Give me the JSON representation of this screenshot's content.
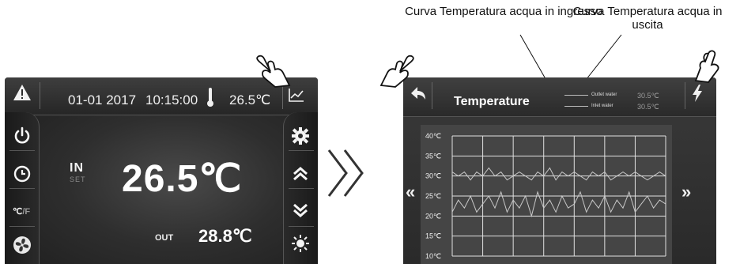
{
  "annotations": {
    "inlet_curve": "Curva Temperatura acqua in ingresso",
    "outlet_curve": "Curva Temperatura acqua in uscita"
  },
  "main_screen": {
    "date": "01-01 2017",
    "time": "10:15:00",
    "ambient_temp": "26.5℃",
    "mode_label": "IN",
    "set_label": "SET",
    "set_temp": "26.5℃",
    "out_label": "OUT",
    "out_temp": "28.8℃",
    "unit_toggle": {
      "c": "℃",
      "f": "/F"
    },
    "icons": {
      "top_left": "warning-icon",
      "top_right": "chart-icon",
      "left_rail": [
        "power-icon",
        "clock-icon",
        "unit-toggle-icon",
        "fan-icon"
      ],
      "right_rail": [
        "gear-icon",
        "chevron-up-icon",
        "chevron-down-icon",
        "sun-icon"
      ]
    }
  },
  "temperature_screen": {
    "title": "Temperature",
    "legend": [
      {
        "name": "Outlet water",
        "value": "30.5℃"
      },
      {
        "name": "Inlet water",
        "value": "30.5℃"
      }
    ],
    "nav_prev": "«",
    "nav_next": "»",
    "icons": {
      "top_left": "back-arrow-icon",
      "top_right": "lightning-icon"
    }
  },
  "chart_data": {
    "type": "line",
    "y_ticks": [
      "40℃",
      "35℃",
      "30℃",
      "25℃",
      "20℃",
      "15℃",
      "10℃"
    ],
    "ylim": [
      10,
      40
    ],
    "grid": true,
    "series": [
      {
        "name": "Outlet water",
        "values": [
          31,
          30,
          31,
          29,
          31,
          30,
          32,
          30,
          31,
          29,
          30,
          31,
          30,
          29,
          31,
          30,
          32,
          29,
          31,
          30,
          31,
          30,
          29,
          31,
          30,
          31,
          29,
          30,
          31,
          30,
          31,
          30,
          29,
          30,
          31,
          30
        ]
      },
      {
        "name": "Inlet water",
        "values": [
          21,
          24,
          22,
          25,
          21,
          23,
          25,
          22,
          26,
          21,
          24,
          22,
          25,
          20,
          26,
          22,
          24,
          21,
          25,
          22,
          23,
          26,
          21,
          24,
          22,
          25,
          21,
          24,
          22,
          26,
          21,
          23,
          25,
          22,
          24,
          23
        ]
      }
    ]
  },
  "colors": {
    "screen_bg": "#2a2a2a",
    "graph_bg": "#454545",
    "grid": "#e0e0e0",
    "line": "#c8c8c8",
    "text": "#ffffff"
  }
}
